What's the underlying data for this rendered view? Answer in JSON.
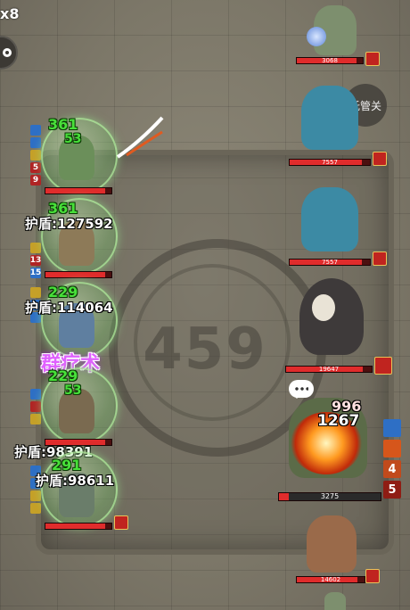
{
  "hud": {
    "speed": "x8",
    "auto_label": "托管关",
    "round": "459"
  },
  "allies": [
    {
      "heal_top": "361",
      "heal_second": "53",
      "buff_nums": [
        "5",
        "9"
      ],
      "hp_fraction": 0.9
    },
    {
      "heal_top": "361",
      "shield": "护盾:127592",
      "buff_nums": [
        "13",
        "15"
      ],
      "hp_fraction": 0.9
    },
    {
      "heal_top": "229",
      "shield": "护盾:114064",
      "hp_fraction": 0.9
    },
    {
      "heal_top": "229",
      "heal_second": "53",
      "shield": "护盾:98391",
      "hp_fraction": 0.9
    },
    {
      "heal_top": "291",
      "shield": "护盾:98611",
      "hp_fraction": 0.9
    }
  ],
  "skill_text": "群疗术",
  "enemies": [
    {
      "name": "stone-golem",
      "hp_text": "3068",
      "hp_fraction": 0.9
    },
    {
      "name": "blue-serpent-a",
      "hp_text": "7557",
      "hp_fraction": 0.9
    },
    {
      "name": "blue-serpent-b",
      "hp_text": "7557",
      "hp_fraction": 0.9
    },
    {
      "name": "grim-reaper",
      "hp_text": "19647",
      "hp_fraction": 0.9
    },
    {
      "name": "turtle-boss",
      "hp_text": "3275",
      "hp_fraction": 0.1,
      "damage_a": "996",
      "damage_b": "1267",
      "stack_nums": [
        "4",
        "5"
      ]
    },
    {
      "name": "rat-warrior",
      "hp_text": "14602",
      "hp_fraction": 0.9
    }
  ],
  "colors": {
    "heal": "#48e03a",
    "hp": "#e02c2c",
    "skill": "#e060ff"
  }
}
